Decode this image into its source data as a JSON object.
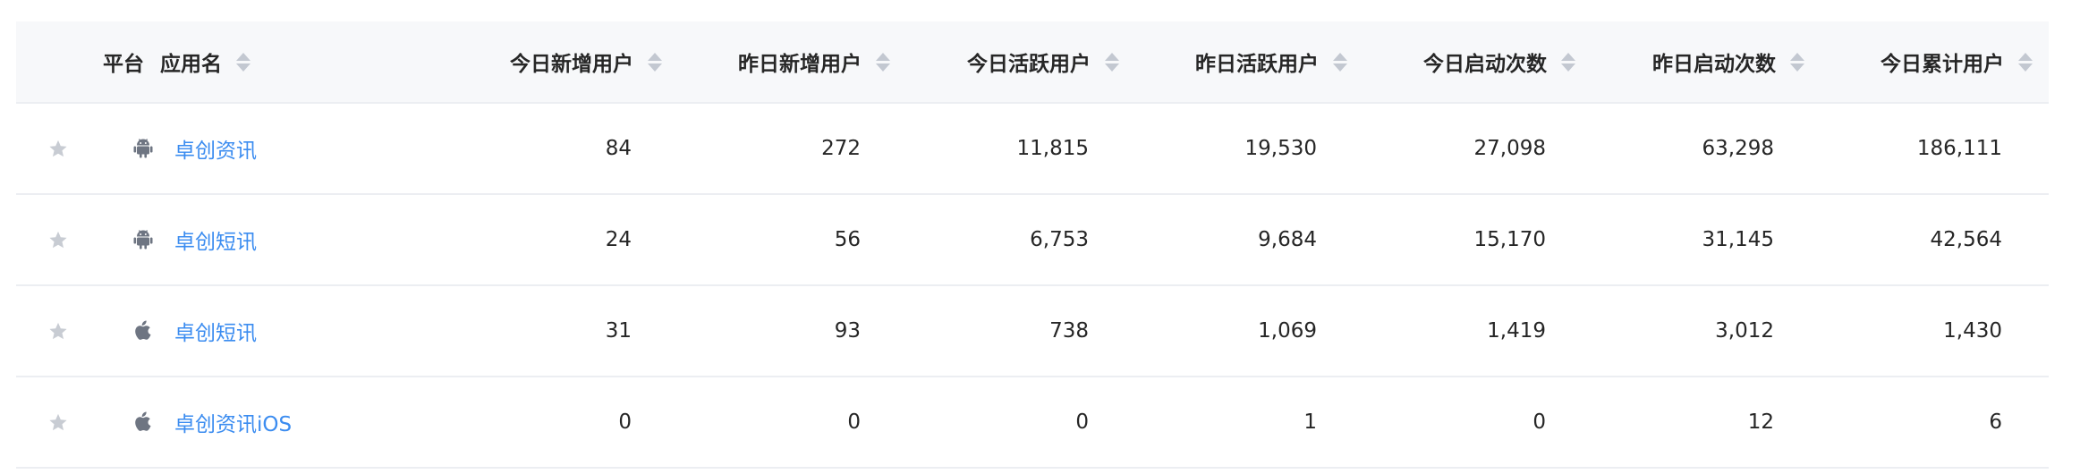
{
  "header": {
    "platform": "平台",
    "app_name": "应用名",
    "columns": [
      "今日新增用户",
      "昨日新增用户",
      "今日活跃用户",
      "昨日活跃用户",
      "今日启动次数",
      "昨日启动次数",
      "今日累计用户"
    ]
  },
  "colors": {
    "link": "#3b8cf0",
    "header_bg": "#f7f8fa",
    "icon": "#6e7582",
    "star": "#c8ccd3"
  },
  "rows": [
    {
      "platform_icon": "android-icon",
      "app_name": "卓创资讯",
      "values": [
        "84",
        "272",
        "11,815",
        "19,530",
        "27,098",
        "63,298",
        "186,111"
      ]
    },
    {
      "platform_icon": "android-icon",
      "app_name": "卓创短讯",
      "values": [
        "24",
        "56",
        "6,753",
        "9,684",
        "15,170",
        "31,145",
        "42,564"
      ]
    },
    {
      "platform_icon": "apple-icon",
      "app_name": "卓创短讯",
      "values": [
        "31",
        "93",
        "738",
        "1,069",
        "1,419",
        "3,012",
        "1,430"
      ]
    },
    {
      "platform_icon": "apple-icon",
      "app_name": "卓创资讯iOS",
      "values": [
        "0",
        "0",
        "0",
        "1",
        "0",
        "12",
        "6"
      ]
    }
  ]
}
